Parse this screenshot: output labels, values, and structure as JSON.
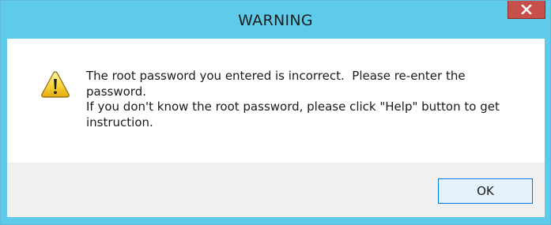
{
  "window": {
    "title": "WARNING",
    "close_icon": "close-x-icon",
    "frame_color": "#5fcbea",
    "close_color": "#c7504a"
  },
  "dialog": {
    "icon": "warning-triangle-icon",
    "message_lines": [
      "The root password you entered is incorrect.  Please re-enter the",
      "password.",
      "If you don't know the root password, please click \"Help\" button to get",
      "instruction."
    ]
  },
  "buttons": {
    "ok_label": "OK"
  }
}
